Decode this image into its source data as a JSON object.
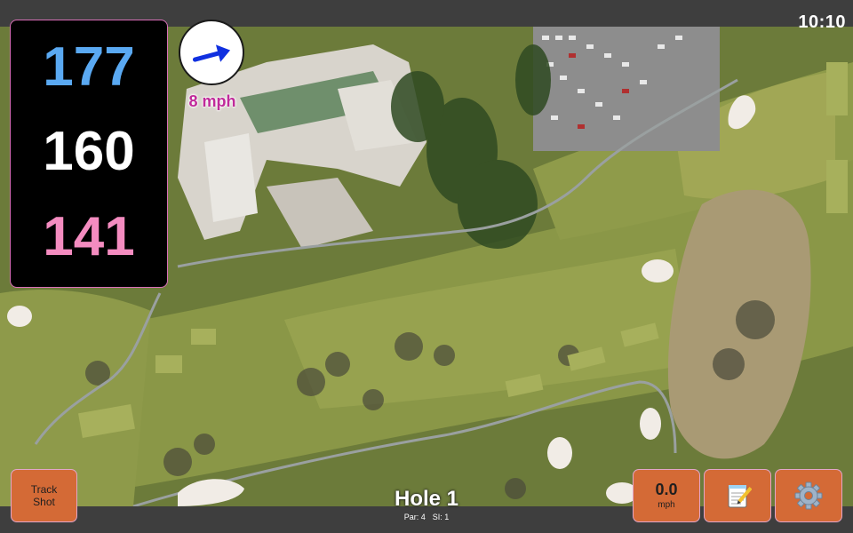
{
  "status_bar": {
    "time": "10:10"
  },
  "yardages": {
    "back": "177",
    "middle": "160",
    "front": "141"
  },
  "wind": {
    "speed_label": "8 mph",
    "direction_deg": 75
  },
  "hole": {
    "title": "Hole 1",
    "par_label": "Par: 4",
    "si_label": "SI: 1"
  },
  "buttons": {
    "track_shot_line1": "Track",
    "track_shot_line2": "Shot",
    "speed_value": "0.0",
    "speed_unit": "mph",
    "notes_icon": "notepad-icon",
    "settings_icon": "gear-icon"
  },
  "colors": {
    "back_yardage": "#5aa9f2",
    "middle_yardage": "#ffffff",
    "front_yardage": "#f48cc0",
    "button_fill": "#d46a36",
    "wind_arrow": "#1030e0",
    "wind_text": "#c02a9a"
  }
}
